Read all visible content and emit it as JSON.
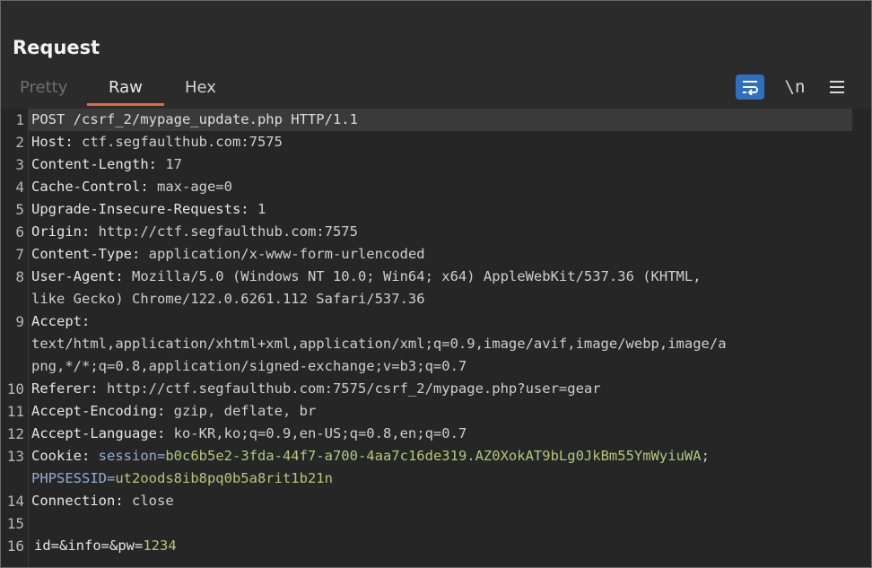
{
  "panel": {
    "title": "Request",
    "tabs": [
      {
        "label": "Pretty"
      },
      {
        "label": "Raw"
      },
      {
        "label": "Hex"
      }
    ],
    "tools": {
      "wrap_icon": "wrap-lines-icon",
      "newline_label": "\\n",
      "menu_icon": "hamburger-menu-icon"
    },
    "colors": {
      "active_tab_underline": "#e86a3a",
      "wrap_button_bg": "#2e6fbf",
      "value_highlight": "#b4c87a"
    }
  },
  "request": {
    "line1": "POST /csrf_2/mypage_update.php HTTP/1.1",
    "host_k": "Host:",
    "host_v": " ctf.segfaulthub.com:7575",
    "cl_k": "Content-Length:",
    "cl_v": " 17",
    "cc_k": "Cache-Control:",
    "cc_v": " max-age=0",
    "uir_k": "Upgrade-Insecure-Requests:",
    "uir_v": " 1",
    "origin_k": "Origin:",
    "origin_v": " http://ctf.segfaulthub.com:7575",
    "ct_k": "Content-Type:",
    "ct_v": " application/x-www-form-urlencoded",
    "ua_k": "User-Agent:",
    "ua_v1": " Mozilla/5.0 (Windows NT 10.0; Win64; x64) AppleWebKit/537.36 (KHTML,",
    "ua_v2": "like Gecko) Chrome/122.0.6261.112 Safari/537.36",
    "accept_k": "Accept:",
    "accept_v1": "text/html,application/xhtml+xml,application/xml;q=0.9,image/avif,image/webp,image/a",
    "accept_v2": "png,*/*;q=0.8,application/signed-exchange;v=b3;q=0.7",
    "ref_k": "Referer:",
    "ref_v": " http://ctf.segfaulthub.com:7575/csrf_2/mypage.php?user=gear",
    "ae_k": "Accept-Encoding:",
    "ae_v": " gzip, deflate, br",
    "al_k": "Accept-Language:",
    "al_v": " ko-KR,ko;q=0.9,en-US;q=0.8,en;q=0.7",
    "cookie_k": "Cookie:",
    "cookie_n1": " session=",
    "cookie_v1": "b0c6b5e2-3fda-44f7-a700-4aa7c16de319.AZ0XokAT9bLg0JkBm55YmWyiuWA",
    "cookie_sep": ";",
    "cookie_n2": "PHPSESSID=",
    "cookie_v2": "ut2oods8ib8pq0b5a8rit1b21n",
    "conn_k": "Connection:",
    "conn_v": " close",
    "body_p1": "id=&info=&pw=",
    "body_v": "1234",
    "line_numbers": [
      "1",
      "2",
      "3",
      "4",
      "5",
      "6",
      "7",
      "8",
      "9",
      "10",
      "11",
      "12",
      "13",
      "14",
      "15",
      "16"
    ]
  }
}
